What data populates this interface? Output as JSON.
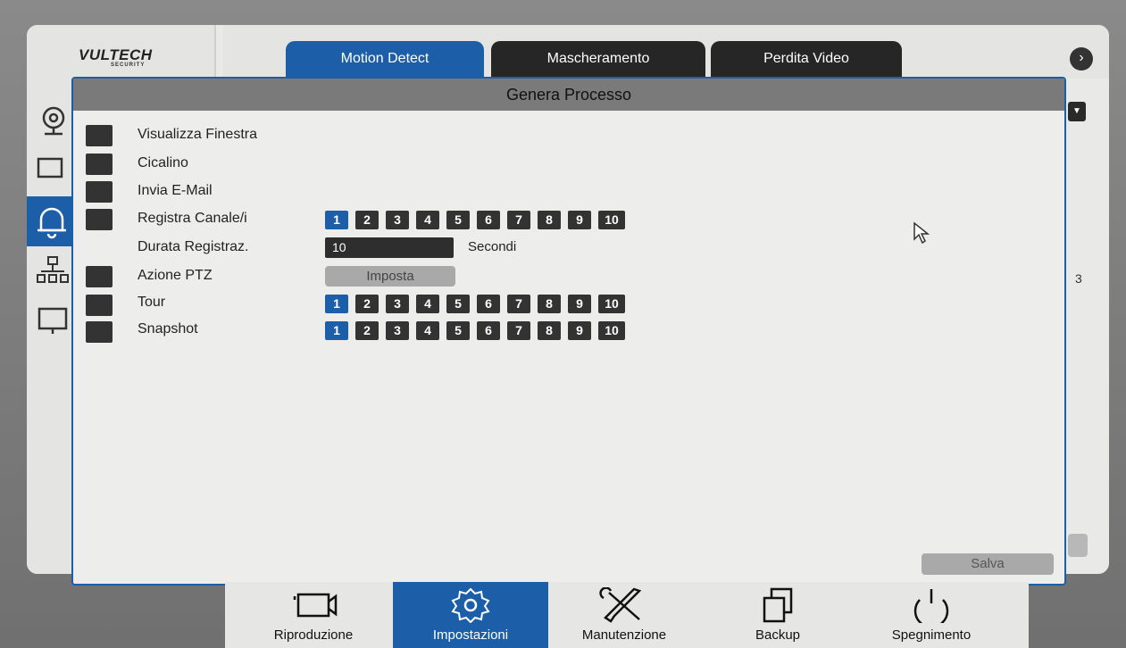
{
  "brand": {
    "logo": "VULTECH",
    "logo_sub": "SECURITY"
  },
  "tabs": [
    {
      "label": "Motion Detect",
      "active": true
    },
    {
      "label": "Mascheramento",
      "active": false
    },
    {
      "label": "Perdita Video",
      "active": false
    }
  ],
  "dialog": {
    "title": "Genera Processo",
    "rows": {
      "show_window": "Visualizza Finestra",
      "buzzer": "Cicalino",
      "send_email": "Invia E-Mail",
      "record_channels": "Registra Canale/i",
      "record_duration": "Durata Registraz.",
      "ptz_action": "Azione PTZ",
      "tour": "Tour",
      "snapshot": "Snapshot"
    },
    "channels": [
      "1",
      "2",
      "3",
      "4",
      "5",
      "6",
      "7",
      "8",
      "9",
      "10"
    ],
    "selected_channel": "1",
    "duration_value": "10",
    "duration_unit": "Secondi",
    "ptz_button": "Imposta",
    "save_button": "Salva"
  },
  "right_number": "3",
  "bottom_nav": [
    {
      "label": "Riproduzione",
      "icon": "camera-icon",
      "active": false
    },
    {
      "label": "Impostazioni",
      "icon": "gear-icon",
      "active": true
    },
    {
      "label": "Manutenzione",
      "icon": "tools-icon",
      "active": false
    },
    {
      "label": "Backup",
      "icon": "copy-icon",
      "active": false
    },
    {
      "label": "Spegnimento",
      "icon": "power-icon",
      "active": false
    }
  ],
  "colors": {
    "accent": "#1d5ea8",
    "dark": "#333333",
    "dialog_title_bg": "#7a7a7a"
  }
}
